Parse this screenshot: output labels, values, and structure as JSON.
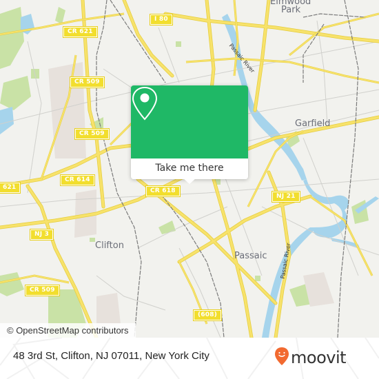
{
  "map": {
    "road_shields": [
      {
        "id": "i80",
        "label": "I 80"
      },
      {
        "id": "cr621-top",
        "label": "CR 621"
      },
      {
        "id": "cr509-a",
        "label": "CR 509"
      },
      {
        "id": "cr509-b",
        "label": "CR 509"
      },
      {
        "id": "cr614",
        "label": "CR 614"
      },
      {
        "id": "cr621-left",
        "label": "621"
      },
      {
        "id": "cr618",
        "label": "CR 618"
      },
      {
        "id": "nj3",
        "label": "NJ 3"
      },
      {
        "id": "cr509-c",
        "label": "CR 509"
      },
      {
        "id": "nj21",
        "label": "NJ 21"
      },
      {
        "id": "r608",
        "label": "(608)"
      }
    ],
    "places": {
      "elmwood_park_1": "Elmwood",
      "elmwood_park_2": "Park",
      "garfield": "Garfield",
      "clifton": "Clifton",
      "passaic": "Passaic"
    },
    "water_labels": {
      "passaic_river_north": "Passaic River",
      "passaic_river_south": "Passaic River"
    },
    "colors": {
      "land": "#f2f2ee",
      "road": "#f7e26b",
      "road_casing": "#e5cd3c",
      "water": "#a6d4ec",
      "park": "#c9e2a6",
      "rail": "#7a7a7a",
      "shield": "#f2de2e"
    },
    "attribution": "© OpenStreetMap contributors"
  },
  "popup": {
    "icon": "map-pin-icon",
    "button_label": "Take me there",
    "color": "#1fb866"
  },
  "footer": {
    "address": "48 3rd St, Clifton, NJ 07011, New York City",
    "logo_text": "moovit",
    "logo_color": "#f26a30"
  }
}
